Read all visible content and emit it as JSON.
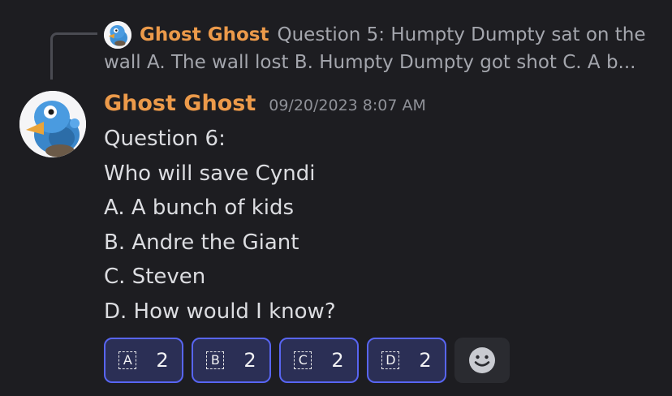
{
  "reply": {
    "author": "Ghost Ghost",
    "line1": "Question 5: Humpty Dumpty sat on the",
    "line2": "wall A. The wall lost B. Humpty Dumpty got shot C. A b..."
  },
  "message": {
    "author": "Ghost Ghost",
    "timestamp": "09/20/2023 8:07 AM",
    "lines": [
      "Question 6:",
      "Who will save Cyndi",
      "A. A bunch of kids",
      "B. Andre the Giant",
      "C. Steven",
      "D. How would I know?"
    ]
  },
  "reactions": [
    {
      "letter": "A",
      "count": "2"
    },
    {
      "letter": "B",
      "count": "2"
    },
    {
      "letter": "C",
      "count": "2"
    },
    {
      "letter": "D",
      "count": "2"
    }
  ],
  "add_reaction_icon": "smiley-face-icon",
  "colors": {
    "background": "#1d1d21",
    "author": "#ec9a4a",
    "reaction_border": "#5865f2",
    "reaction_bg": "#2b2f55"
  }
}
